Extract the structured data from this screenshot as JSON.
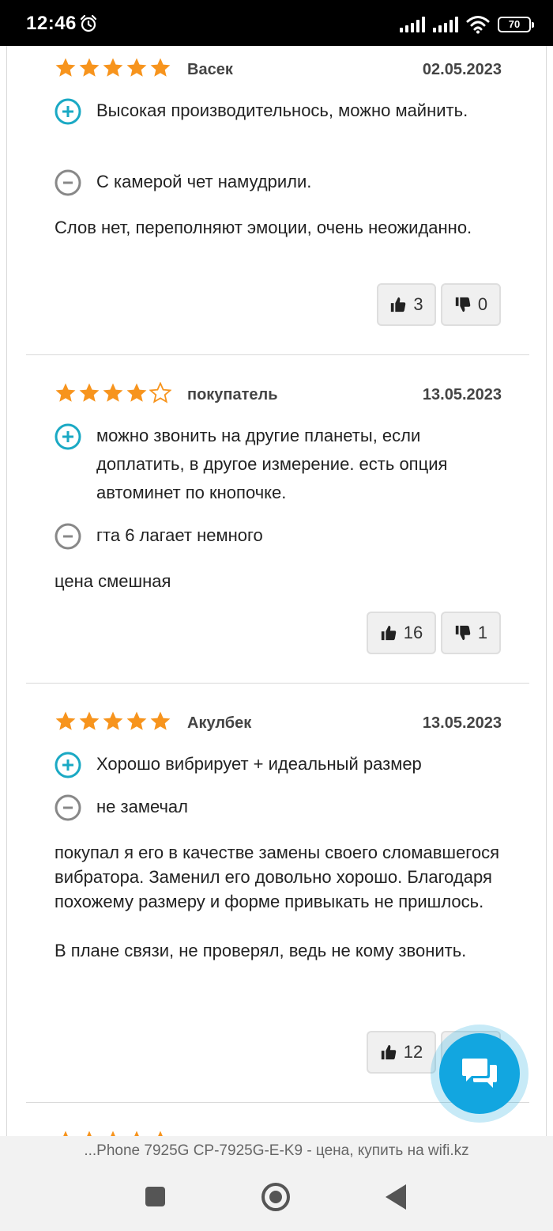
{
  "status_bar": {
    "time": "12:46",
    "battery": "70",
    "icons": [
      "alarm-icon",
      "signal-icon",
      "signal-icon",
      "wifi-icon",
      "battery-icon"
    ]
  },
  "colors": {
    "star": "#f7941d",
    "plus": "#1aa9c4",
    "minus": "#888888",
    "fab": "#12a6e0"
  },
  "reviews": [
    {
      "rating": 5,
      "author": "Васек",
      "date": "02.05.2023",
      "pros": "Высокая производительнось, можно майнить.",
      "cons": "С камерой чет намудрили.",
      "comment": "Слов нет, переполняют эмоции, очень неожиданно.",
      "likes": "3",
      "dislikes": "0"
    },
    {
      "rating": 4,
      "author": "покупатель",
      "date": "13.05.2023",
      "pros": "можно звонить на другие планеты, если доплатить, в другое измерение. есть опция автоминет по кнопочке.",
      "cons": "гта 6 лагает немного",
      "comment": "цена смешная",
      "likes": "16",
      "dislikes": "1"
    },
    {
      "rating": 5,
      "author": "Акулбек",
      "date": "13.05.2023",
      "pros": "Хорошо вибрирует + идеальный размер",
      "cons": "не замечал",
      "comment": "покупал я его в качестве замены своего сломавшегося вибратора. Заменил его довольно хорошо. Благодаря похожему размеру и форме привыкать не пришлось.\n\nВ плане связи, не проверял, ведь не кому звонить.",
      "likes": "12",
      "dislikes": ""
    }
  ],
  "url_bar": {
    "text": "...Phone 7925G CP-7925G-E-K9 - цена, купить на wifi.kz"
  },
  "nav": {
    "icons": [
      "recents-icon",
      "home-icon",
      "back-icon"
    ]
  }
}
